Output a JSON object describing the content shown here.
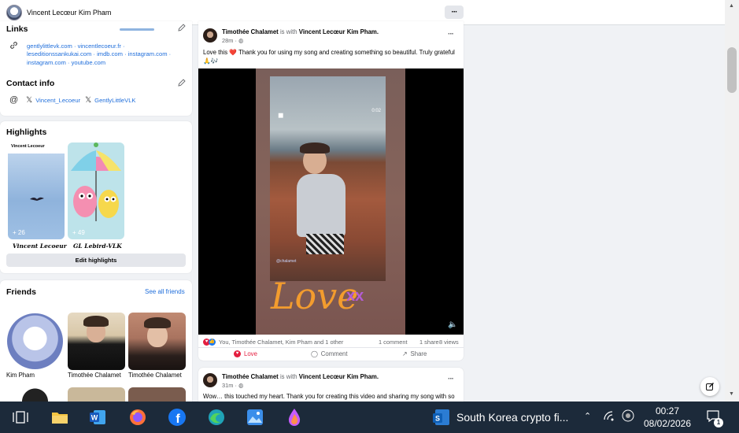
{
  "header": {
    "title": "Vincent Lecœur Kim Pham",
    "more_label": "···"
  },
  "links": {
    "heading": "Links",
    "urls": [
      "gentlylittlevk.com",
      "vincentlecoeur.fr",
      "leseditionssankukai.com",
      "imdb.com",
      "instagram.com",
      "instagram.com",
      "youtube.com"
    ]
  },
  "contact": {
    "heading": "Contact info",
    "accounts": [
      "Vincent_Lecoeur",
      "GentlyLittleVLK"
    ]
  },
  "highlights": {
    "heading": "Highlights",
    "items": [
      {
        "label": "Vincent Lecoeur",
        "count": "+ 26",
        "top_text": "Vincent Lecoeur"
      },
      {
        "label": "GL Lebird-VLK",
        "count": "+ 49"
      }
    ],
    "edit_label": "Edit highlights"
  },
  "friends": {
    "heading": "Friends",
    "see_all": "See all friends",
    "items": [
      {
        "name": "Kim Pham"
      },
      {
        "name": "Timothée Chalamet"
      },
      {
        "name": "Timothée Chalamet"
      }
    ]
  },
  "post1": {
    "author": "Timothée Chalamet",
    "with_text": "is with",
    "tagged": "Vincent Lecœur Kim Pham.",
    "time": "28m",
    "text": "Love this ❤️ Thank you for using my song and creating something so beautiful. Truly grateful 🙏🎶",
    "video_timer": "0:02",
    "video_tag": "@chalamet",
    "video_overlay_text": "Love",
    "reactions_text": "You, Timothée Chalamet, Kim Pham and 1 other",
    "comments": "1 comment",
    "shares": "1 share",
    "views": "8 views",
    "love_label": "Love",
    "comment_label": "Comment",
    "share_label": "Share"
  },
  "post2": {
    "author": "Timothée Chalamet",
    "with_text": "is with",
    "tagged": "Vincent Lecœur Kim Pham.",
    "time": "31m",
    "text": "Wow… this touched my heart. Thank you for creating this video and sharing my song with so"
  },
  "taskbar": {
    "news": "South Korea crypto fi...",
    "time": "00:27",
    "date": "08/02/2026",
    "notifications": "1"
  },
  "colors": {
    "link": "#216fdb",
    "taskbar": "#1c2a3a",
    "love": "#e41e3f"
  }
}
